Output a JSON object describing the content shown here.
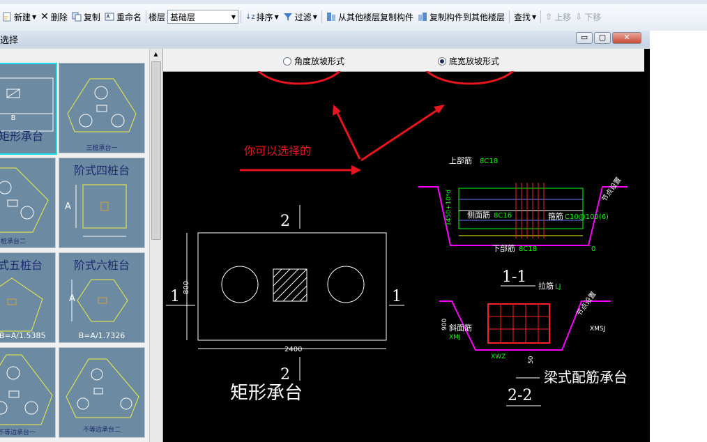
{
  "toolbar": {
    "new_label": "新建",
    "delete_label": "删除",
    "copy_label": "复制",
    "rename_label": "重命名",
    "floor_label": "楼层",
    "floor_value": "基础层",
    "sort_label": "排序",
    "filter_label": "过滤",
    "copy_from_other_label": "从其他楼层复制构件",
    "copy_to_other_label": "复制构件到其他楼层",
    "find_label": "查找",
    "move_up_label": "上移",
    "move_down_label": "下移"
  },
  "window": {
    "title": "选择",
    "min_glyph": "▭",
    "max_glyph": "▢",
    "close_glyph": "✕"
  },
  "options": {
    "angle_label": "角度放坡形式",
    "width_label": "底宽放坡形式",
    "selected": "width"
  },
  "thumbnails": {
    "rect_caption": "矩形承台",
    "rect_b": "B",
    "three_pile_caption": "三桩承台一",
    "three_pile_b_caption": "桩承台二",
    "step_four_caption": "阶式四桩台",
    "step_four_a": "A",
    "step_five_caption": "式五桩台",
    "step_five_formula": "B=A/1.5385",
    "step_six_caption": "阶式六桩台",
    "step_six_a": "A",
    "step_six_formula": "B=A/1.7326",
    "irregular_one_caption": "不等边承台一",
    "irregular_two_caption": "不等边承台二"
  },
  "cad": {
    "annotation": "你可以选择的",
    "plan_title": "矩形承台",
    "section_1": "1",
    "section_2": "2",
    "dim_800": "800",
    "dim_2400": "2400",
    "top_bar": "上部筋",
    "top_bar_spec": "8C18",
    "side_bar": "侧面筋",
    "side_bar_spec": "8C16",
    "stirrup": "箍筋",
    "stirrup_spec": "C10@100(6)",
    "bottom_bar": "下部筋",
    "bottom_bar_spec": "8C18",
    "dim_0": "0",
    "vertical_dim": "1450+10*d",
    "section_11": "1-1",
    "tie_bar": "拉筋",
    "tie_bar_spec": "LJ",
    "slope_bar": "斜面筋",
    "slope_bar_spec": "XMJ",
    "xmsj": "XMSJ",
    "xwz": "XWZ",
    "dim_900": "900",
    "dim_50": "50",
    "beam_type": "梁式配筋承台",
    "section_22": "2-2",
    "slope_note": "节点设置"
  },
  "colors": {
    "annotation_red": "#e8141e",
    "cad_bg": "#000000",
    "cad_white": "#ffffff",
    "cad_green": "#00ff00",
    "cad_magenta": "#ff00ff",
    "cad_yellow": "#ffff00",
    "thumb_bg": "#6c8aa2"
  }
}
